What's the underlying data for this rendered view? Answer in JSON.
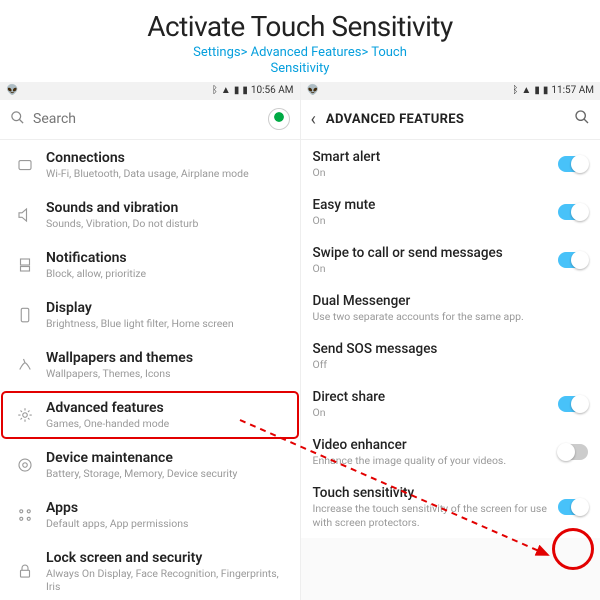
{
  "header": {
    "title": "Activate Touch Sensitivity",
    "breadcrumb_line1": "Settings> Advanced Features> Touch",
    "breadcrumb_line2": "Sensitivity"
  },
  "left": {
    "status_time": "10:56 AM",
    "search_placeholder": "Search",
    "items": [
      {
        "title": "Connections",
        "sub": "Wi-Fi, Bluetooth, Data usage, Airplane mode"
      },
      {
        "title": "Sounds and vibration",
        "sub": "Sounds, Vibration, Do not disturb"
      },
      {
        "title": "Notifications",
        "sub": "Block, allow, prioritize"
      },
      {
        "title": "Display",
        "sub": "Brightness, Blue light filter, Home screen"
      },
      {
        "title": "Wallpapers and themes",
        "sub": "Wallpapers, Themes, Icons"
      },
      {
        "title": "Advanced features",
        "sub": "Games, One-handed mode"
      },
      {
        "title": "Device maintenance",
        "sub": "Battery, Storage, Memory, Device security"
      },
      {
        "title": "Apps",
        "sub": "Default apps, App permissions"
      },
      {
        "title": "Lock screen and security",
        "sub": "Always On Display, Face Recognition, Fingerprints, Iris"
      }
    ]
  },
  "right": {
    "status_time": "11:57 AM",
    "topbar_title": "ADVANCED FEATURES",
    "items": [
      {
        "title": "Smart alert",
        "sub": "On",
        "toggle": true
      },
      {
        "title": "Easy mute",
        "sub": "On",
        "toggle": true
      },
      {
        "title": "Swipe to call or send messages",
        "sub": "On",
        "toggle": true
      },
      {
        "title": "Dual Messenger",
        "sub": "Use two separate accounts for the same app.",
        "toggle": null
      },
      {
        "title": "Send SOS messages",
        "sub": "Off",
        "toggle": null
      },
      {
        "title": "Direct share",
        "sub": "On",
        "toggle": true
      },
      {
        "title": "Video enhancer",
        "sub": "Enhance the image quality of your videos.",
        "toggle": false
      },
      {
        "title": "Touch sensitivity",
        "sub": "Increase the touch sensitivity of the screen for use with screen protectors.",
        "toggle": true
      }
    ]
  }
}
